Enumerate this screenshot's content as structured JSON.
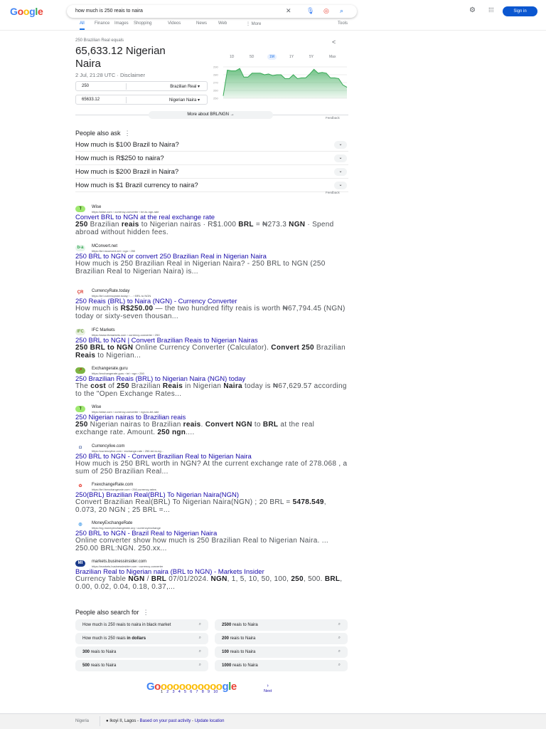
{
  "header": {
    "logo": "Google",
    "query": "how much is 250 reais to naira",
    "sign_in": "Sign in"
  },
  "tabs": [
    "All",
    "Finance",
    "Images",
    "Shopping",
    "Videos",
    "News",
    "Web",
    "⋮ More"
  ],
  "tools": "Tools",
  "converter": {
    "caption": "250 Brazilian Real equals",
    "result_line1": "65,633.12 Nigerian",
    "result_line2": "Naira",
    "timestamp": "2 Jul, 21:28 UTC · Disclaimer",
    "from_value": "250",
    "from_unit": "Brazilian Real",
    "to_value": "65633.12",
    "to_unit": "Nigerian Naira",
    "more": "More about BRL/NGN  →",
    "feedback": "Feedback"
  },
  "chart_data": {
    "type": "area",
    "ranges": [
      "1D",
      "5D",
      "1M",
      "1Y",
      "5Y",
      "Max"
    ],
    "selected_range": "1M",
    "yticks": [
      "290",
      "280",
      "270",
      "260",
      "250"
    ],
    "ylim": [
      250,
      290
    ],
    "values": [
      253,
      286,
      285,
      285,
      288,
      277,
      277,
      282,
      282,
      282,
      280,
      281,
      279,
      280,
      280,
      275,
      275,
      280,
      275,
      276,
      276,
      281,
      287,
      282,
      283,
      282,
      276,
      276,
      275,
      267,
      264
    ],
    "color": "#34a853"
  },
  "paa": {
    "title": "People also ask",
    "questions": [
      "How much is $100 Brazil to Naira?",
      "How much is R$250 to naira?",
      "How much is $200 Brazil in Naira?",
      "How much is $1 Brazil currency to naira?"
    ],
    "feedback": "Feedback"
  },
  "results": [
    {
      "site": "Wise",
      "url": "https://wise.com › currency-converter › brl-to-ngn-rate",
      "title": "Convert BRL to NGN at the real exchange rate",
      "fav": "⁊",
      "favbg": "#9fe870",
      "favfg": "#163300",
      "snip": [
        [
          "250",
          1
        ],
        [
          " Brazilian ",
          0
        ],
        [
          "reais",
          1
        ],
        [
          " to Nigerian nairas · R$1.000 ",
          0
        ],
        [
          "BRL",
          1
        ],
        [
          " = ₦273.3 ",
          0
        ],
        [
          "NGN",
          1
        ],
        [
          " · Spend abroad without hidden fees.",
          0
        ]
      ]
    },
    {
      "site": "MConvert.net",
      "url": "https://brl.mconvert.net › ngn › 250",
      "title": "250 BRL to NGN or convert 250 Brazilian Real in Nigerian Naira",
      "fav": "b-a",
      "favbg": "#e6f4ea",
      "favfg": "#34a853",
      "snip": [
        [
          "How much is 250 Brazilian Real in Nigerian Naira? - 250 BRL to NGN (250 Brazilian Real to Nigerian Naira) is...",
          0
        ]
      ]
    },
    {
      "site": "CurrencyRate.today",
      "url": "https://brl.currencyrate.today › ... › BRL to NGN",
      "title": "250 Reais (BRL) to Naira (NGN) - Currency Converter",
      "fav": "ÇR",
      "favbg": "#fff",
      "favfg": "#d93025",
      "snip": [
        [
          "How much is ",
          0
        ],
        [
          "R$250.00",
          1
        ],
        [
          " — the two hundred fifty reais is worth ₦67,794.45 (NGN) today or sixty-seven thousan...",
          0
        ]
      ]
    },
    {
      "site": "IFC Markets",
      "url": "https://www.ifcmarkets.com › currency-converter › 250",
      "title": "250 BRL to NGN | Convert Brazilian Reais to Nigerian Nairas",
      "fav": "IFC",
      "favbg": "#e8f0e0",
      "favfg": "#6a9a3a",
      "snip": [
        [
          "250 BRL to NGN",
          1
        ],
        [
          " Online Currency Converter (Calculator). ",
          0
        ],
        [
          "Convert 250",
          1
        ],
        [
          " Brazilian ",
          0
        ],
        [
          "Reais",
          1
        ],
        [
          " to Nigerian...",
          0
        ]
      ]
    },
    {
      "site": "Exchangerate.guru",
      "url": "https://exchangerate.guru › brl › ngn › 250",
      "title": "250 Brazilian Reais (BRL) to Nigerian Naira (NGN) today",
      "fav": "↗",
      "favbg": "#7cb342",
      "favfg": "#c62828",
      "snip": [
        [
          "The ",
          0
        ],
        [
          "cost",
          1
        ],
        [
          " of ",
          0
        ],
        [
          "250",
          1
        ],
        [
          " Brazilian ",
          0
        ],
        [
          "Reais",
          1
        ],
        [
          " in Nigerian ",
          0
        ],
        [
          "Naira",
          1
        ],
        [
          " today is ₦67,629.57 according to the \"Open Exchange Rates...",
          0
        ]
      ]
    },
    {
      "site": "Wise",
      "url": "https://wise.com › currency-converter › ngn-to-brl-rate",
      "title": "250 Nigerian nairas to Brazilian reais",
      "fav": "⁊",
      "favbg": "#9fe870",
      "favfg": "#163300",
      "snip": [
        [
          "250",
          1
        ],
        [
          " Nigerian nairas to Brazilian ",
          0
        ],
        [
          "reais",
          1
        ],
        [
          ". ",
          0
        ],
        [
          "Convert NGN",
          1
        ],
        [
          " to ",
          0
        ],
        [
          "BRL",
          1
        ],
        [
          " at the real exchange rate. Amount. ",
          0
        ],
        [
          "250 ngn",
          1
        ],
        [
          "....",
          0
        ]
      ]
    },
    {
      "site": "Currencylive.com",
      "url": "https://currencylive.com › exchange-rate › 250-brl-to-ng...",
      "title": "250 BRL to NGN - Convert Brazilian Real to Nigerian Naira",
      "fav": "◘",
      "favbg": "#fff",
      "favfg": "#1a3a8a",
      "snip": [
        [
          "How much is 250 BRL worth in NGN? At the current exchange rate of 278.068 , a sum of 250 Brazilian Real...",
          0
        ]
      ]
    },
    {
      "site": "FxexchangeRate.com",
      "url": "https://brl.fxexchangerate.com › 250-currency-rates",
      "title": "250(BRL) Brazilian Real(BRL) To Nigerian Naira(NGN)",
      "fav": "✿",
      "favbg": "#fff",
      "favfg": "#e8453c",
      "snip": [
        [
          "Convert Brazilian Real(BRL) To Nigerian Naira(NGN) ; 20 BRL = ",
          0
        ],
        [
          "5478.549",
          1
        ],
        [
          ", 0.073, 20 NGN ; 25 BRL =...",
          0
        ]
      ]
    },
    {
      "site": "MoneyExchangeRate",
      "url": "https://ng.moneyexchangerate.org › currencyexchange",
      "title": "250 BRL to NGN - Brazil Real to Nigerian Naira",
      "fav": "◎",
      "favbg": "#fff",
      "favfg": "#1e88e5",
      "snip": [
        [
          "Online converter show how much is 250 Brazilian Real to Nigerian Naira. ... 250.00 BRL:NGN. 250.xx...",
          0
        ]
      ]
    },
    {
      "site": "markets.businessinsider.com",
      "url": "https://markets.businessinsider.com › currency-converter",
      "title": "Brazilian Real to Nigerian naira (BRL to NGN) - Markets Insider",
      "fav": "MI",
      "favbg": "#1a3a8a",
      "favfg": "#fff",
      "snip": [
        [
          "Currency Table ",
          0
        ],
        [
          "NGN",
          1
        ],
        [
          " / ",
          0
        ],
        [
          "BRL",
          1
        ],
        [
          " 07/01/2024. ",
          0
        ],
        [
          "NGN",
          1
        ],
        [
          ", 1, 5, 10, 50, 100, ",
          0
        ],
        [
          "250",
          1
        ],
        [
          ", 500. ",
          0
        ],
        [
          "BRL",
          1
        ],
        [
          ", 0.00, 0.02, 0.04, 0.18, 0.37,...",
          0
        ]
      ]
    }
  ],
  "also_search": {
    "title": "People also search for",
    "items": [
      [
        [
          "How much is 250 reais to naira in black market",
          0
        ]
      ],
      [
        [
          "2500",
          1
        ],
        [
          " reais to Naira",
          0
        ]
      ],
      [
        [
          "How much is 250 reais ",
          0
        ],
        [
          "in dollars",
          1
        ]
      ],
      [
        [
          "200",
          1
        ],
        [
          " reais to Naira",
          0
        ]
      ],
      [
        [
          "300",
          1
        ],
        [
          " reais to Naira",
          0
        ]
      ],
      [
        [
          "100",
          1
        ],
        [
          " reais to Naira",
          0
        ]
      ],
      [
        [
          "500",
          1
        ],
        [
          " reais to Naira",
          0
        ]
      ],
      [
        [
          "1000",
          1
        ],
        [
          " reais to Naira",
          0
        ]
      ]
    ]
  },
  "pagination": {
    "pages": [
      "1",
      "2",
      "3",
      "4",
      "5",
      "6",
      "7",
      "8",
      "9",
      "10"
    ],
    "next": "Next"
  },
  "footer": {
    "country": "Nigeria",
    "location": "Ikoyi II, Lagos",
    "past_activity": "Based on your past activity",
    "update": "Update location"
  }
}
